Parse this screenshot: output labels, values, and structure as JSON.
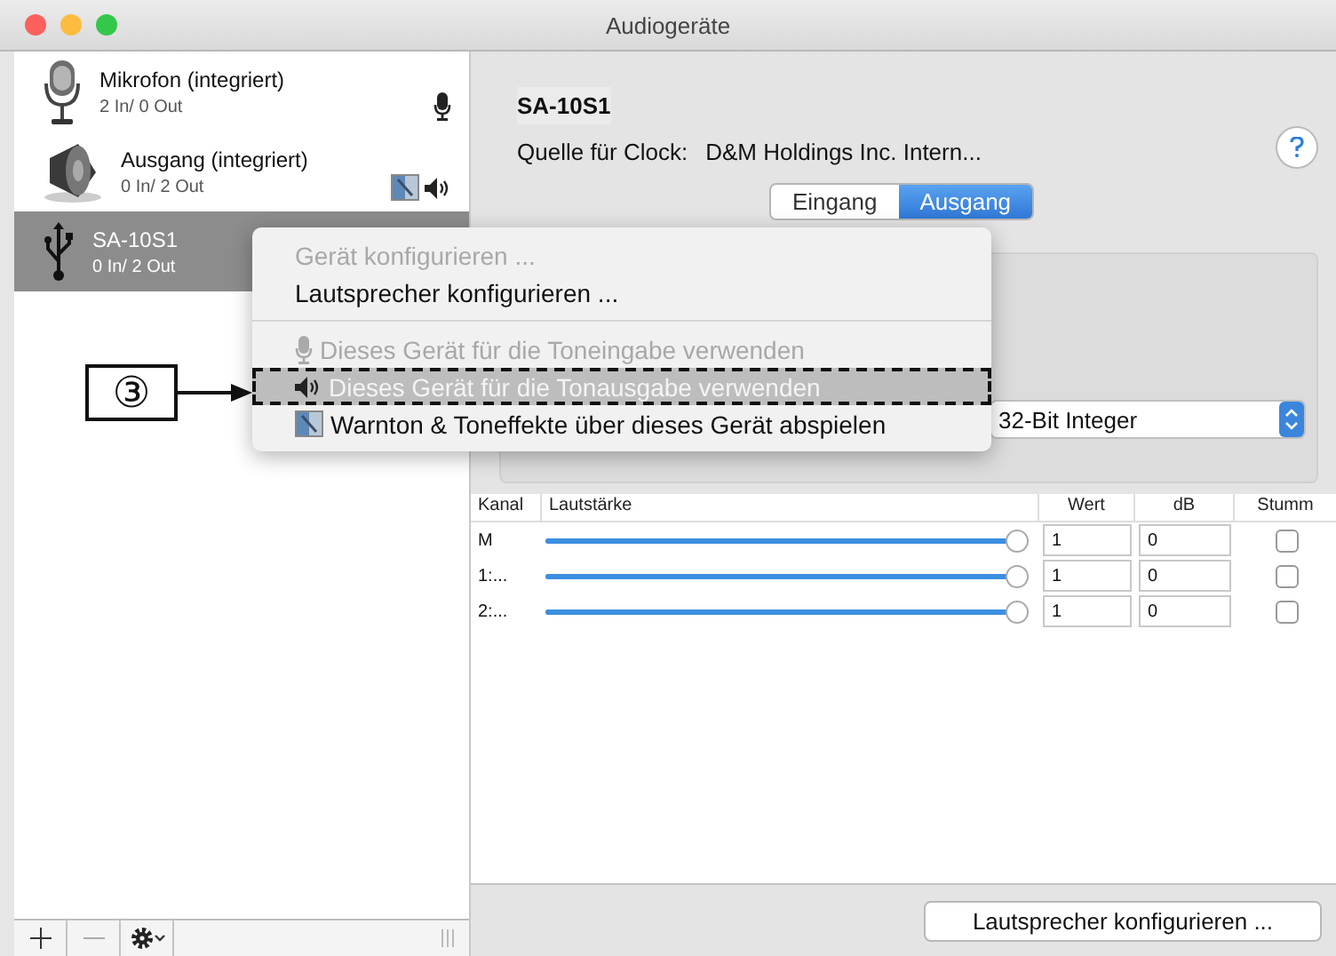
{
  "window": {
    "title": "Audiogeräte"
  },
  "sidebar": {
    "devices": [
      {
        "name": "Mikrofon (integriert)",
        "io": "2 In/ 0 Out",
        "kind": "microphone",
        "selected": false,
        "default_input": true,
        "default_output": false,
        "system_output": false
      },
      {
        "name": "Ausgang (integriert)",
        "io": "0 In/ 2 Out",
        "kind": "speaker",
        "selected": false,
        "default_input": false,
        "default_output": true,
        "system_output": true
      },
      {
        "name": "SA-10S1",
        "io": "0 In/ 2 Out",
        "kind": "usb",
        "selected": true,
        "default_input": false,
        "default_output": false,
        "system_output": false
      }
    ]
  },
  "detail": {
    "device_name": "SA-10S1",
    "clock_label": "Quelle für Clock:",
    "clock_value": "D&M Holdings Inc. Intern...",
    "tabs": [
      {
        "label": "Eingang",
        "selected": false
      },
      {
        "label": "Ausgang",
        "selected": true
      }
    ],
    "format_select": {
      "value": "32-Bit Integer"
    },
    "table": {
      "columns": [
        "Kanal",
        "Lautstärke",
        "Wert",
        "dB",
        "Stumm"
      ],
      "rows": [
        {
          "channel": "M",
          "level": 1,
          "value": "1",
          "db": "0",
          "muted": false
        },
        {
          "channel": "1:...",
          "level": 1,
          "value": "1",
          "db": "0",
          "muted": false
        },
        {
          "channel": "2:...",
          "level": 1,
          "value": "1",
          "db": "0",
          "muted": false
        }
      ]
    },
    "button": "Lautsprecher konfigurieren ..."
  },
  "context_menu": {
    "items": [
      {
        "kind": "plain",
        "label": "Gerät konfigurieren ...",
        "disabled": true,
        "selected": false
      },
      {
        "kind": "plain",
        "label": "Lautsprecher konfigurieren ...",
        "disabled": false,
        "selected": false
      },
      {
        "kind": "separator"
      },
      {
        "kind": "microphone",
        "label": "Dieses Gerät für die Toneingabe verwenden",
        "disabled": true,
        "selected": false
      },
      {
        "kind": "speaker",
        "label": "Dieses Gerät für die Tonausgabe verwenden",
        "disabled": false,
        "selected": true
      },
      {
        "kind": "app",
        "label": "Warnton & Toneffekte über dieses Gerät abspielen",
        "disabled": false,
        "selected": false
      }
    ]
  },
  "annotation": {
    "label": "③"
  }
}
